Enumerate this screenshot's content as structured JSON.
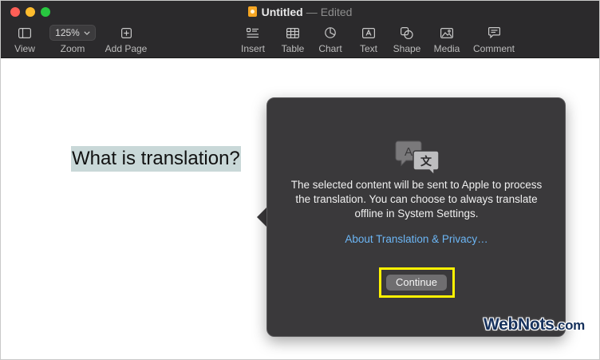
{
  "window": {
    "title": "Untitled",
    "separator": "—",
    "status": "Edited"
  },
  "toolbar": {
    "view": "View",
    "zoom_value": "125%",
    "zoom": "Zoom",
    "add_page": "Add Page",
    "insert": "Insert",
    "table": "Table",
    "chart": "Chart",
    "text": "Text",
    "shape": "Shape",
    "media": "Media",
    "comment": "Comment"
  },
  "document": {
    "selected_text": "What is translation?"
  },
  "popover": {
    "message": "The selected content will be sent to Apple to process the translation. You can choose to always translate offline in System Settings.",
    "link": "About Translation & Privacy…",
    "continue": "Continue"
  },
  "watermark": {
    "brand": "WebNots",
    "suffix": ".com"
  },
  "colors": {
    "toolbar_bg": "#2b2a2c",
    "popover_bg": "#3a393b",
    "link": "#6cb6f5",
    "highlight": "#fff200",
    "selection": "#c9d8d8"
  }
}
